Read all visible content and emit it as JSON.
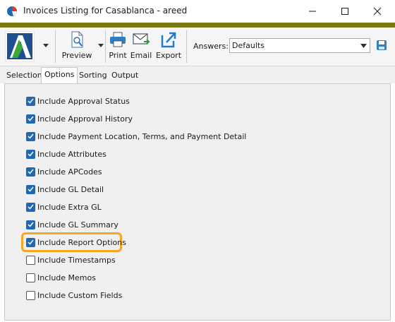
{
  "window": {
    "title": "Invoices Listing for Casablanca - areed",
    "controls": [
      "minimize",
      "maximize",
      "close"
    ]
  },
  "colors": {
    "accent_strip": "#7a7a10",
    "checkbox_checked": "#1e68b6",
    "highlight": "#f5a623"
  },
  "toolbar": {
    "buttons": [
      {
        "label": "Preview",
        "icon": "preview-icon"
      },
      {
        "label": "Print",
        "icon": "printer-icon"
      },
      {
        "label": "Email",
        "icon": "email-icon"
      },
      {
        "label": "Export",
        "icon": "export-icon"
      }
    ],
    "answers_label": "Answers:",
    "answers_value": "Defaults"
  },
  "tabs": [
    {
      "label": "Selection",
      "active": false
    },
    {
      "label": "Options",
      "active": true
    },
    {
      "label": "Sorting",
      "active": false
    },
    {
      "label": "Output",
      "active": false
    }
  ],
  "options": [
    {
      "label": "Include Approval Status",
      "checked": true
    },
    {
      "label": "Include Approval History",
      "checked": true
    },
    {
      "label": "Include Payment Location, Terms, and Payment Detail",
      "checked": true
    },
    {
      "label": "Include Attributes",
      "checked": true
    },
    {
      "label": "Include APCodes",
      "checked": true
    },
    {
      "label": "Include GL Detail",
      "checked": true
    },
    {
      "label": "Include Extra GL",
      "checked": true
    },
    {
      "label": "Include GL Summary",
      "checked": true
    },
    {
      "label": "Include Report Options",
      "checked": true,
      "highlighted": true
    },
    {
      "label": "Include Timestamps",
      "checked": false
    },
    {
      "label": "Include Memos",
      "checked": false
    },
    {
      "label": "Include Custom Fields",
      "checked": false
    }
  ]
}
